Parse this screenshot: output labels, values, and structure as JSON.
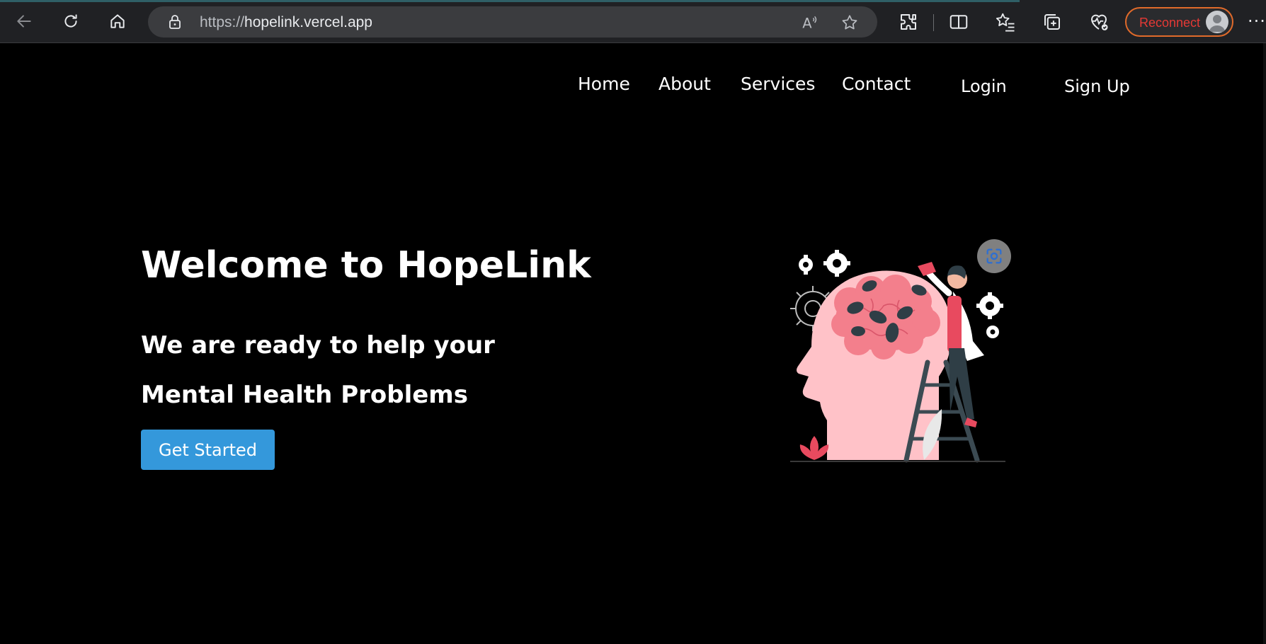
{
  "browser": {
    "url_protocol": "https://",
    "url_host": "hopelink.vercel.app",
    "reconnect_label": "Reconnect",
    "icons": [
      "back-icon",
      "refresh-icon",
      "home-icon",
      "lock-icon",
      "read-aloud-icon",
      "favorite-star-icon",
      "extensions-icon",
      "split-screen-icon",
      "favorites-icon",
      "collections-icon",
      "browser-health-icon",
      "profile-avatar-icon",
      "more-icon"
    ],
    "accent_color": "#e06a2a"
  },
  "nav": {
    "items": [
      {
        "label": "Home"
      },
      {
        "label": "About"
      },
      {
        "label": "Services"
      },
      {
        "label": "Contact"
      }
    ],
    "login": "Login",
    "signup": "Sign Up"
  },
  "hero": {
    "title": "Welcome to HopeLink",
    "subtitle_line1": "We are ready to help your",
    "subtitle_line2": "Mental Health Problems",
    "cta_label": "Get Started",
    "cta_color": "#3498db"
  }
}
